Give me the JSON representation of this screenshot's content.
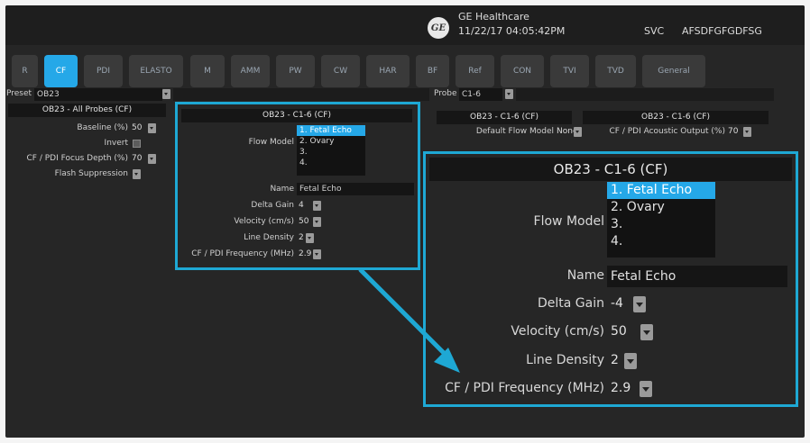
{
  "header": {
    "company": "GE Healthcare",
    "datetime": "11/22/17 04:05:42PM",
    "svc_label": "SVC",
    "svc_id": "AFSDFGFGDFSG"
  },
  "tabs": [
    "R",
    "CF",
    "PDI",
    "ELASTO",
    "M",
    "AMM",
    "PW",
    "CW",
    "HAR",
    "BF",
    "Ref",
    "CON",
    "TVI",
    "TVD",
    "General"
  ],
  "active_tab": "CF",
  "preset": {
    "label": "Preset",
    "value": "OB23"
  },
  "probe": {
    "label": "Probe",
    "value": "C1-6"
  },
  "left_panel": {
    "title": "OB23 - All Probes (CF)",
    "baseline_label": "Baseline (%)",
    "baseline_value": "50",
    "invert_label": "Invert",
    "focus_label": "CF / PDI Focus Depth (%)",
    "focus_value": "70",
    "flash_label": "Flash Suppression"
  },
  "center_panel": {
    "title": "OB23 - C1-6 (CF)",
    "flow_model_label": "Flow Model",
    "flow_items": [
      "1. Fetal Echo",
      "2. Ovary",
      "3.",
      "4."
    ],
    "name_label": "Name",
    "name_value": "Fetal Echo",
    "delta_gain_label": "Delta Gain",
    "delta_gain_value": "4",
    "velocity_label": "Velocity (cm/s)",
    "velocity_value": "50",
    "line_density_label": "Line Density",
    "line_density_value": "2",
    "frequency_label": "CF / PDI Frequency (MHz)",
    "frequency_value": "2.9"
  },
  "right_panel_1": {
    "title": "OB23 - C1-6 (CF)",
    "default_flow_label": "Default Flow Model",
    "default_flow_value": "None"
  },
  "right_panel_2": {
    "title": "OB23 - C1-6 (CF)",
    "acoustic_label": "CF / PDI Acoustic Output (%)",
    "acoustic_value": "70"
  },
  "zoom_panel": {
    "title": "OB23 - C1-6 (CF)",
    "flow_model_label": "Flow Model",
    "flow_items": [
      "1. Fetal Echo",
      "2. Ovary",
      "3.",
      "4."
    ],
    "name_label": "Name",
    "name_value": "Fetal Echo",
    "delta_gain_label": "Delta Gain",
    "delta_gain_value": "-4",
    "velocity_label": "Velocity (cm/s)",
    "velocity_value": "50",
    "line_density_label": "Line Density",
    "line_density_value": "2",
    "frequency_label": "CF / PDI Frequency (MHz)",
    "frequency_value": "2.9"
  },
  "colors": {
    "accent": "#25a8e8",
    "frame": "#1ea8d4",
    "background": "#262626"
  }
}
